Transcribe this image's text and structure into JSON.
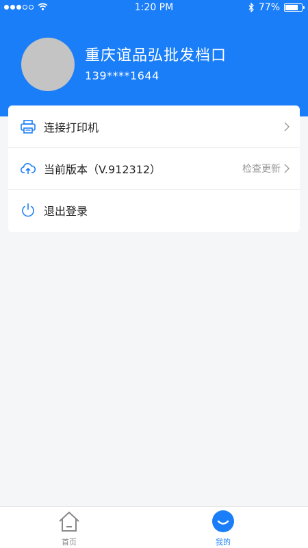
{
  "status_bar": {
    "time": "1:20 PM",
    "battery": "77%",
    "battery_level": 0.77
  },
  "profile": {
    "shop_name": "重庆谊品弘批发档口",
    "phone": "139****1644"
  },
  "menu": {
    "connect_printer": {
      "label": "连接打印机",
      "icon": "printer-icon"
    },
    "version": {
      "label": "当前版本（V.912312）",
      "action": "检查更新",
      "icon": "cloud-upload-icon"
    },
    "logout": {
      "label": "退出登录",
      "icon": "power-icon"
    }
  },
  "tabbar": {
    "home": {
      "label": "首页",
      "icon": "home-icon"
    },
    "mine": {
      "label": "我的",
      "icon": "smile-icon"
    }
  },
  "colors": {
    "accent": "#1a7ef8",
    "background": "#f5f6f8"
  }
}
